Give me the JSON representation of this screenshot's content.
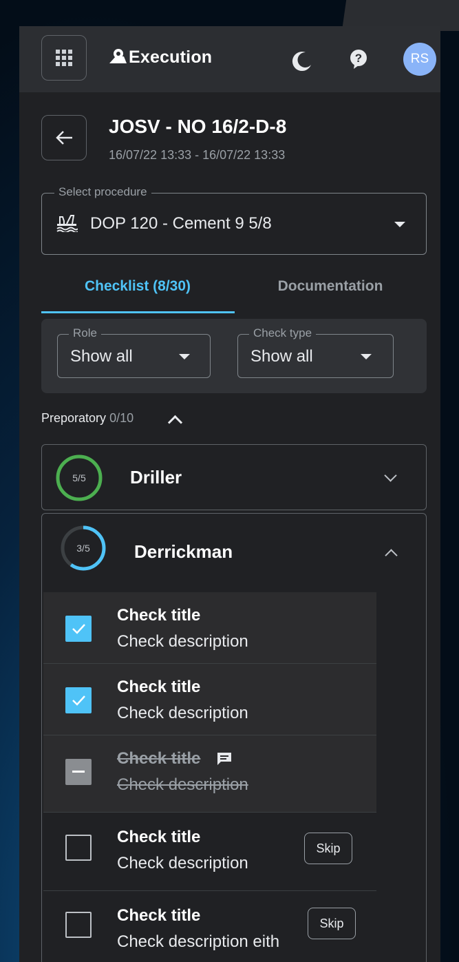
{
  "app": {
    "name": "Execution",
    "avatar_initials": "RS"
  },
  "header": {
    "title": "JOSV - NO 16/2-D-8",
    "subtitle": "16/07/22 13:33 - 16/07/22 13:33"
  },
  "procedure": {
    "label": "Select procedure",
    "value": "DOP 120 - Cement 9 5/8"
  },
  "tabs": [
    {
      "label": "Checklist (8/30)",
      "active": true
    },
    {
      "label": "Documentation",
      "active": false
    }
  ],
  "filters": {
    "role": {
      "label": "Role",
      "value": "Show all"
    },
    "check_type": {
      "label": "Check type",
      "value": "Show all"
    }
  },
  "section": {
    "title": "Preporatory",
    "count": "0/10"
  },
  "roles": [
    {
      "name": "Driller",
      "progress": "5/5",
      "fraction": 1.0,
      "color": "#4caf50"
    },
    {
      "name": "Derrickman",
      "progress": "3/5",
      "fraction": 0.6,
      "color": "#4fc3f7"
    }
  ],
  "checks": [
    {
      "title": "Check title",
      "description": "Check description",
      "state": "checked"
    },
    {
      "title": "Check title",
      "description": "Check description",
      "state": "checked"
    },
    {
      "title": "Check title",
      "description": "Check description",
      "state": "skipped"
    },
    {
      "title": "Check title",
      "description": "Check description",
      "state": "unchecked",
      "action": "Skip"
    },
    {
      "title": "Check title",
      "description": "Check description eith",
      "state": "unchecked",
      "action": "Skip"
    }
  ],
  "colors": {
    "accent": "#4fc3f7",
    "complete": "#4caf50",
    "surface": "#202124",
    "topbar": "#2c2e32"
  }
}
